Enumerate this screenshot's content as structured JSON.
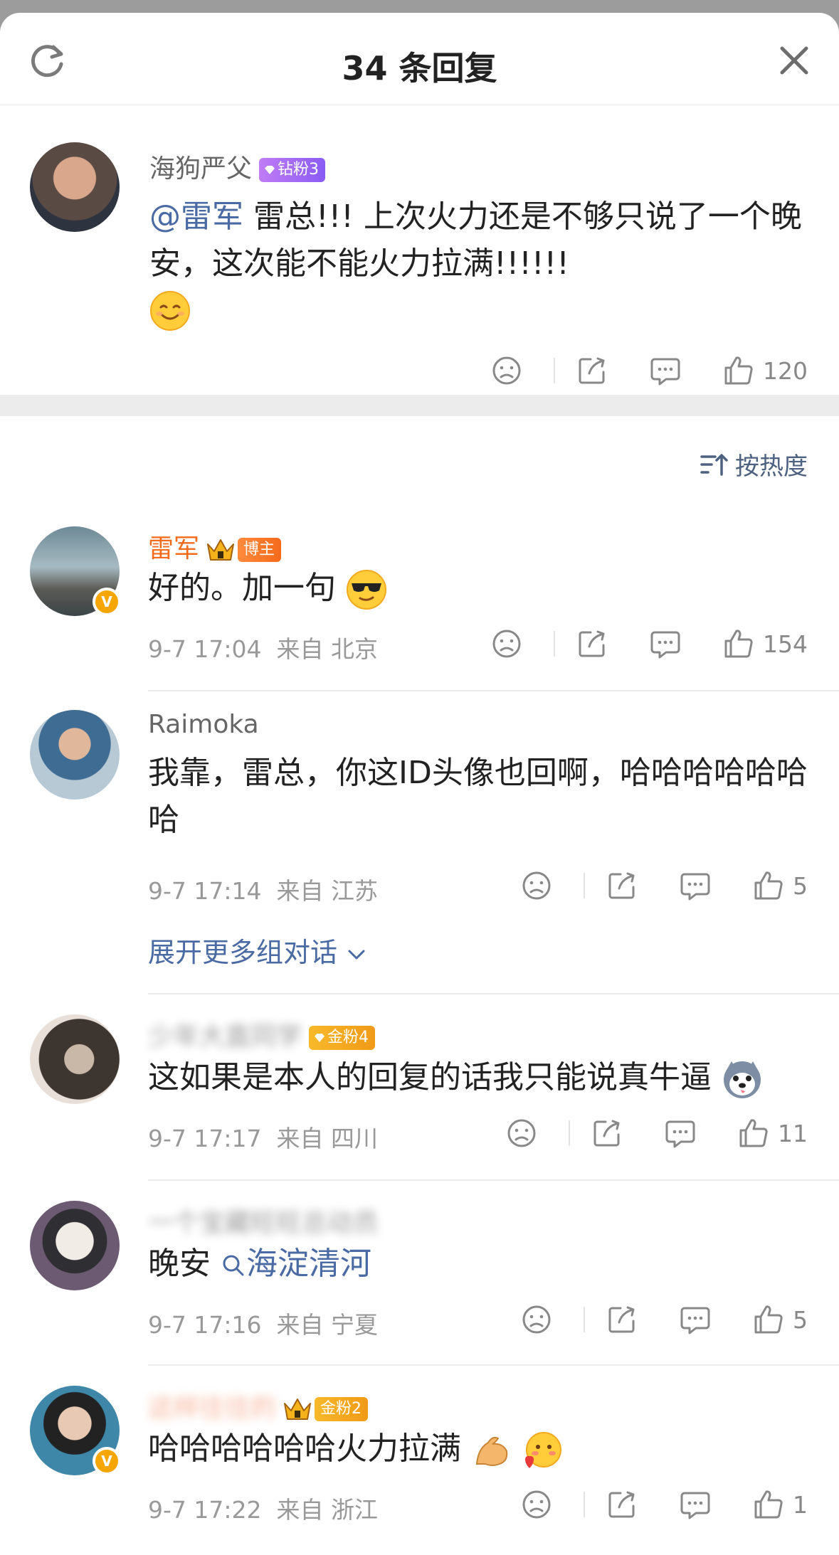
{
  "header": {
    "title": "34 条回复"
  },
  "root": {
    "username": "海狗严父",
    "badge": "钻粉3",
    "mention": "@雷军",
    "text": " 雷总!!! 上次火力还是不够只说了一个晚安，这次能不能火力拉满!!!!!!",
    "emoji": "smile-emoji",
    "likes": "120"
  },
  "sort_label": "按热度",
  "replies": [
    {
      "username": "雷军",
      "badge": "博主",
      "text": "好的。加一句",
      "emoji": "sunglasses-emoji",
      "time": "9-7 17:04",
      "location": "来自 北京",
      "likes": "154"
    },
    {
      "username": "Raimoka",
      "text": "我靠，雷总，你这ID头像也回啊，哈哈哈哈哈哈哈",
      "time": "9-7 17:14",
      "location": "来自 江苏",
      "likes": "5",
      "expand_label": "展开更多组对话"
    },
    {
      "username": "少年大直同学",
      "badge": "金粉4",
      "text": "这如果是本人的回复的话我只能说真牛逼",
      "emoji": "husky-emoji",
      "time": "9-7 17:17",
      "location": "来自 四川",
      "likes": "11"
    },
    {
      "username": "一个宝藏旺旺总动员",
      "text": "晚安",
      "link": "海淀清河",
      "time": "9-7 17:16",
      "location": "来自 宁夏",
      "likes": "5"
    },
    {
      "username": "这样往往的",
      "badge": "金粉2",
      "text": "哈哈哈哈哈哈火力拉满",
      "emoji": "muscle-emoji",
      "time": "9-7 17:22",
      "location": "来自 浙江",
      "likes": "1"
    }
  ]
}
